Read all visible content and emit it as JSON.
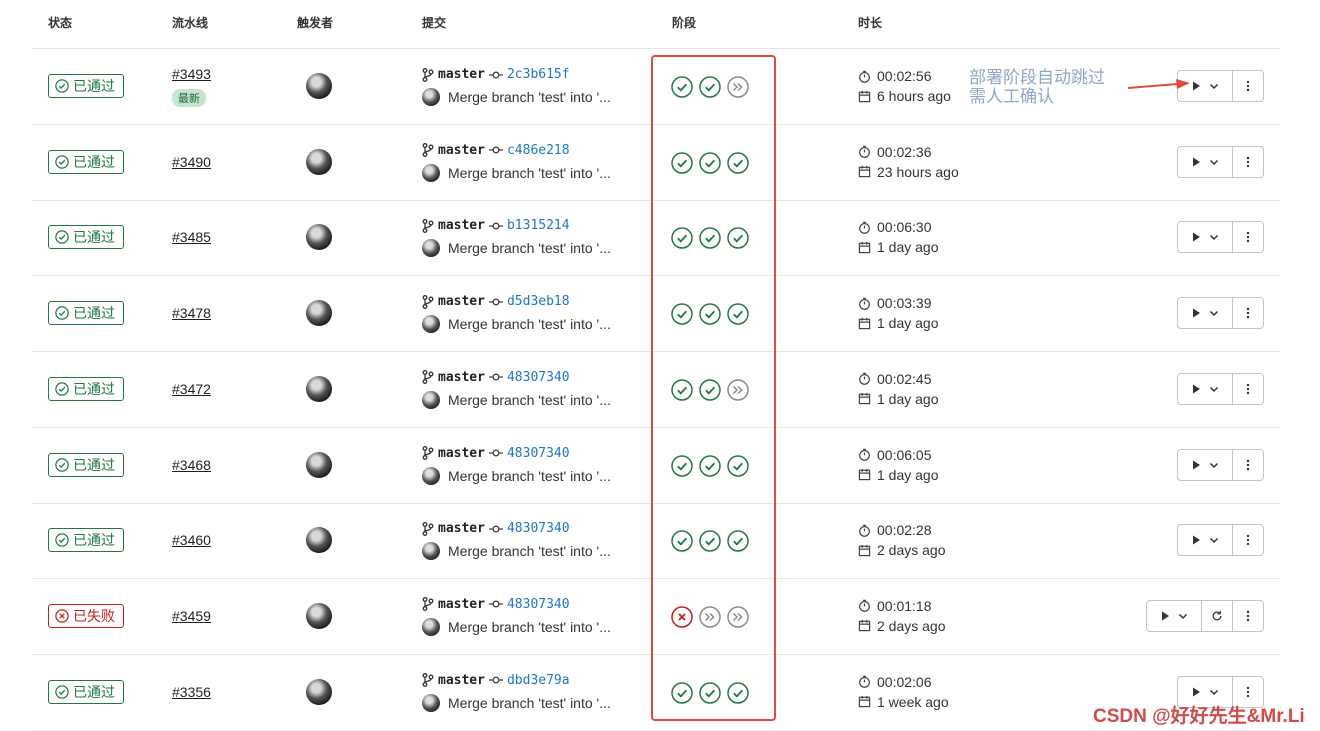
{
  "headers": {
    "status": "状态",
    "pipeline": "流水线",
    "trigger": "触发者",
    "commit": "提交",
    "stages": "阶段",
    "duration": "时长"
  },
  "latest_label": "最新",
  "annotation": {
    "line1": "部署阶段自动跳过",
    "line2": "需人工确认"
  },
  "watermark": "CSDN @好好先生&Mr.Li",
  "colors": {
    "success": "#1f7a3c",
    "failed": "#c91c1c",
    "link": "#1f75cb",
    "highlight": "#e04a3f"
  },
  "rows": [
    {
      "status": "已通过",
      "state": "success",
      "id": "#3493",
      "latest": true,
      "branch": "master",
      "sha": "2c3b615f",
      "message": "Merge branch 'test' into '...",
      "stages": [
        "success",
        "success",
        "skipped"
      ],
      "duration": "00:02:56",
      "ago": "6 hours ago",
      "retry": false
    },
    {
      "status": "已通过",
      "state": "success",
      "id": "#3490",
      "latest": false,
      "branch": "master",
      "sha": "c486e218",
      "message": "Merge branch 'test' into '...",
      "stages": [
        "success",
        "success",
        "success"
      ],
      "duration": "00:02:36",
      "ago": "23 hours ago",
      "retry": false
    },
    {
      "status": "已通过",
      "state": "success",
      "id": "#3485",
      "latest": false,
      "branch": "master",
      "sha": "b1315214",
      "message": "Merge branch 'test' into '...",
      "stages": [
        "success",
        "success",
        "success"
      ],
      "duration": "00:06:30",
      "ago": "1 day ago",
      "retry": false
    },
    {
      "status": "已通过",
      "state": "success",
      "id": "#3478",
      "latest": false,
      "branch": "master",
      "sha": "d5d3eb18",
      "message": "Merge branch 'test' into '...",
      "stages": [
        "success",
        "success",
        "success"
      ],
      "duration": "00:03:39",
      "ago": "1 day ago",
      "retry": false
    },
    {
      "status": "已通过",
      "state": "success",
      "id": "#3472",
      "latest": false,
      "branch": "master",
      "sha": "48307340",
      "message": "Merge branch 'test' into '...",
      "stages": [
        "success",
        "success",
        "skipped"
      ],
      "duration": "00:02:45",
      "ago": "1 day ago",
      "retry": false
    },
    {
      "status": "已通过",
      "state": "success",
      "id": "#3468",
      "latest": false,
      "branch": "master",
      "sha": "48307340",
      "message": "Merge branch 'test' into '...",
      "stages": [
        "success",
        "success",
        "success"
      ],
      "duration": "00:06:05",
      "ago": "1 day ago",
      "retry": false
    },
    {
      "status": "已通过",
      "state": "success",
      "id": "#3460",
      "latest": false,
      "branch": "master",
      "sha": "48307340",
      "message": "Merge branch 'test' into '...",
      "stages": [
        "success",
        "success",
        "success"
      ],
      "duration": "00:02:28",
      "ago": "2 days ago",
      "retry": false
    },
    {
      "status": "已失败",
      "state": "failed",
      "id": "#3459",
      "latest": false,
      "branch": "master",
      "sha": "48307340",
      "message": "Merge branch 'test' into '...",
      "stages": [
        "failed",
        "skipped",
        "skipped"
      ],
      "duration": "00:01:18",
      "ago": "2 days ago",
      "retry": true
    },
    {
      "status": "已通过",
      "state": "success",
      "id": "#3356",
      "latest": false,
      "branch": "master",
      "sha": "dbd3e79a",
      "message": "Merge branch 'test' into '...",
      "stages": [
        "success",
        "success",
        "success"
      ],
      "duration": "00:02:06",
      "ago": "1 week ago",
      "retry": false
    }
  ]
}
